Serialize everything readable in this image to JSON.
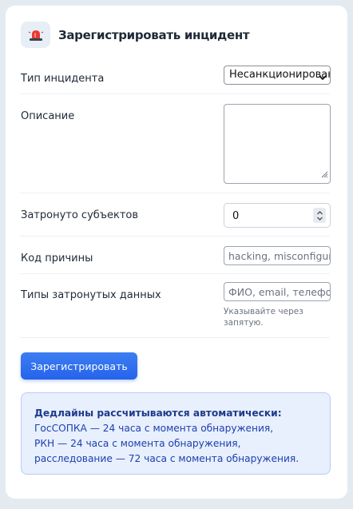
{
  "header": {
    "title": "Зарегистрировать инцидент",
    "icon": "siren-icon"
  },
  "form": {
    "incident_type": {
      "label": "Тип инцидента",
      "selected": "Несанкционированный доступ"
    },
    "description": {
      "label": "Описание",
      "value": ""
    },
    "affected_subjects": {
      "label": "Затронуто субъектов",
      "value": "0"
    },
    "reason_code": {
      "label": "Код причины",
      "placeholder": "hacking, misconfiguration"
    },
    "data_types": {
      "label": "Типы затронутых данных",
      "placeholder": "ФИО, email, телефон",
      "hint": "Указывайте через запятую."
    },
    "submit_label": "Зарегистрировать"
  },
  "info": {
    "title": "Дедлайны рассчитываются автоматически:",
    "lines": [
      "ГосСОПКА — 24 часа с момента обнаружения,",
      "РКН — 24 часа с момента обнаружения,",
      "расследование — 72 часа с момента обнаружения."
    ]
  },
  "colors": {
    "accent": "#2563eb",
    "icon_red": "#e53935",
    "info_bg": "#e8effd",
    "info_text": "#1e40af"
  }
}
